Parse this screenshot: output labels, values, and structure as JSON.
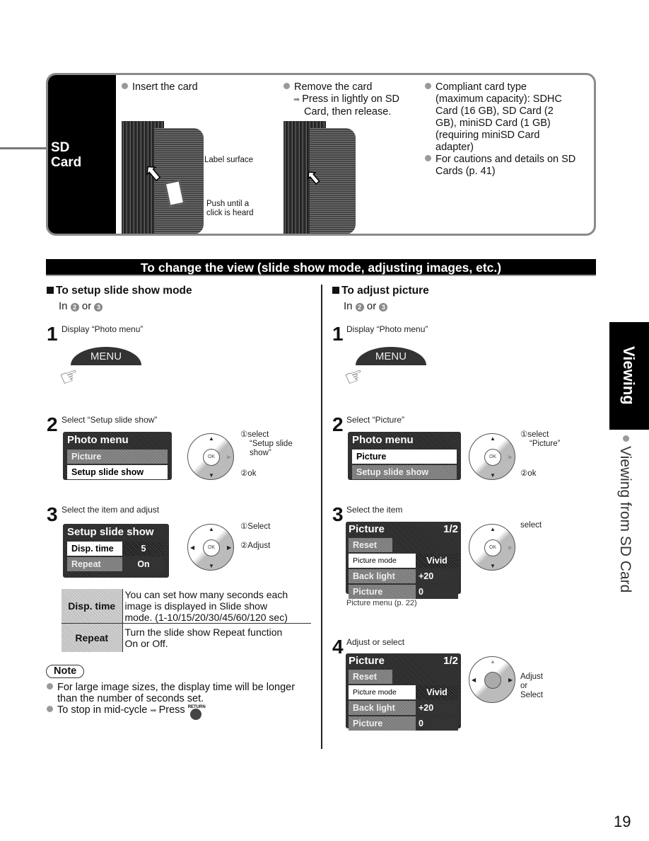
{
  "sd_section": {
    "tab_label_1": "SD",
    "tab_label_2": "Card",
    "insert": {
      "title": "Insert the card",
      "label_surface": "Label surface",
      "push_1": "Push until a",
      "push_2": "click is heard"
    },
    "remove": {
      "title": "Remove the card",
      "line_1": "Press in lightly on SD",
      "line_2": "Card, then release."
    },
    "compliant": {
      "lines": [
        "Compliant card type",
        "(maximum capacity): SDHC",
        "Card (16 GB), SD Card (2",
        "GB), miniSD Card (1 GB)",
        "(requiring miniSD Card",
        "adapter)"
      ]
    },
    "cautions": {
      "lines": [
        "For cautions and details on SD",
        "Cards (p. 41)"
      ]
    }
  },
  "banner": "To change the view (slide show mode, adjusting images, etc.)",
  "left": {
    "title": "To setup slide show mode",
    "sub_in": "In",
    "sub_or": "or",
    "circle_a": "2",
    "circle_b": "3",
    "step1": {
      "num": "1",
      "text": "Display “Photo menu”",
      "button": "MENU"
    },
    "step2": {
      "num": "2",
      "text": "Select “Setup slide show”",
      "menu_title": "Photo menu",
      "items": [
        "Picture",
        "Setup slide show"
      ],
      "label_1a": "①select",
      "label_1b": "“Setup slide",
      "label_1c": "show”",
      "label_2": "②ok"
    },
    "step3": {
      "num": "3",
      "text": "Select the item and adjust",
      "menu_title": "Setup slide show",
      "rows": [
        {
          "label": "Disp. time",
          "value": "5"
        },
        {
          "label": "Repeat",
          "value": "On"
        }
      ],
      "label_1": "①Select",
      "label_2": "②Adjust"
    },
    "table": [
      {
        "key": "Disp. time",
        "lines": [
          "You can set how many seconds each",
          "image is displayed in Slide show",
          "mode. (1-10/15/20/30/45/60/120 sec)"
        ]
      },
      {
        "key": "Repeat",
        "lines": [
          "Turn the slide show Repeat function",
          "On or Off."
        ]
      }
    ],
    "note": {
      "label": "Note",
      "item1_a": "For large image sizes, the display time will be longer",
      "item1_b": "than the number of seconds set.",
      "item2": "To stop in mid-cycle",
      "item2_press": "Press",
      "return_label": "RETURN"
    }
  },
  "right": {
    "title": "To adjust picture",
    "sub_in": "In",
    "sub_or": "or",
    "circle_a": "2",
    "circle_b": "3",
    "step1": {
      "num": "1",
      "text": "Display “Photo menu”",
      "button": "MENU"
    },
    "step2": {
      "num": "2",
      "text": "Select “Picture”",
      "menu_title": "Photo menu",
      "items": [
        "Picture",
        "Setup slide show"
      ],
      "label_1a": "①select",
      "label_1b": "“Picture”",
      "label_2": "②ok"
    },
    "step3": {
      "num": "3",
      "text": "Select the item",
      "menu_title": "Picture",
      "page": "1/2",
      "rows": [
        {
          "label": "Reset",
          "value": ""
        },
        {
          "label": "Picture mode",
          "value": "Vivid"
        },
        {
          "label": "Back light",
          "value": "+20"
        },
        {
          "label": "Picture",
          "value": "0"
        }
      ],
      "label_1": "select",
      "caption": "Picture menu (p. 22)"
    },
    "step4": {
      "num": "4",
      "text": "Adjust or select",
      "menu_title": "Picture",
      "page": "1/2",
      "rows": [
        {
          "label": "Reset",
          "value": ""
        },
        {
          "label": "Picture mode",
          "value": "Vivid"
        },
        {
          "label": "Back light",
          "value": "+20"
        },
        {
          "label": "Picture",
          "value": "0"
        }
      ],
      "label_1": "Adjust",
      "label_2": "or",
      "label_3": "Select"
    }
  },
  "side_tab": "Viewing",
  "side_text": "Viewing from SD Card",
  "page_number": "19"
}
